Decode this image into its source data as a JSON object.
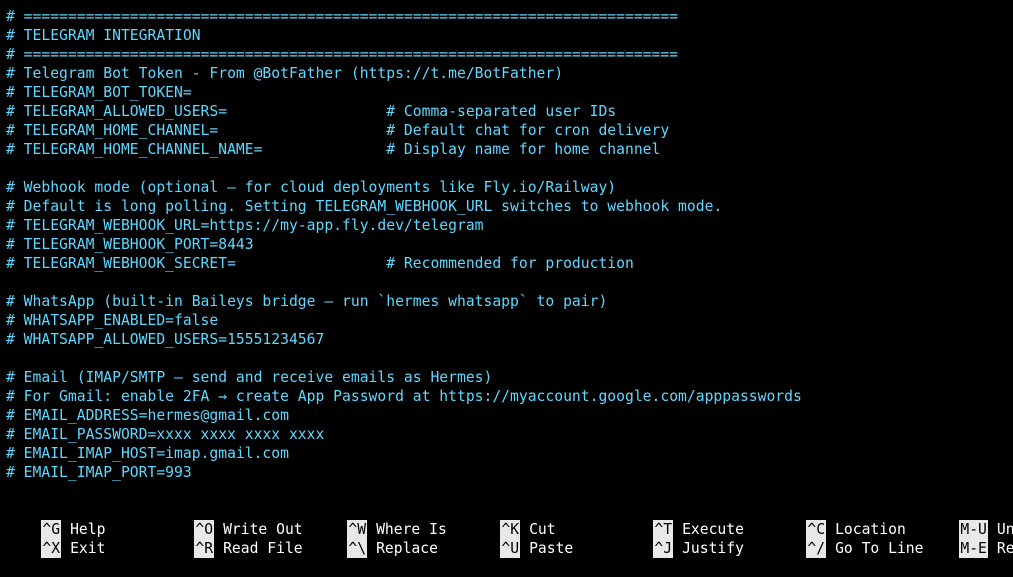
{
  "editor": {
    "lines": [
      "# ==========================================================================",
      "# TELEGRAM INTEGRATION",
      "# ==========================================================================",
      "# Telegram Bot Token - From @BotFather (https://t.me/BotFather)",
      "# TELEGRAM_BOT_TOKEN=",
      "# TELEGRAM_ALLOWED_USERS=                  # Comma-separated user IDs",
      "# TELEGRAM_HOME_CHANNEL=                   # Default chat for cron delivery",
      "# TELEGRAM_HOME_CHANNEL_NAME=              # Display name for home channel",
      "",
      "# Webhook mode (optional — for cloud deployments like Fly.io/Railway)",
      "# Default is long polling. Setting TELEGRAM_WEBHOOK_URL switches to webhook mode.",
      "# TELEGRAM_WEBHOOK_URL=https://my-app.fly.dev/telegram",
      "# TELEGRAM_WEBHOOK_PORT=8443",
      "# TELEGRAM_WEBHOOK_SECRET=                 # Recommended for production",
      "",
      "# WhatsApp (built-in Baileys bridge — run `hermes whatsapp` to pair)",
      "# WHATSAPP_ENABLED=false",
      "# WHATSAPP_ALLOWED_USERS=15551234567",
      "",
      "# Email (IMAP/SMTP — send and receive emails as Hermes)",
      "# For Gmail: enable 2FA → create App Password at https://myaccount.google.com/apppasswords",
      "# EMAIL_ADDRESS=hermes@gmail.com",
      "# EMAIL_PASSWORD=xxxx xxxx xxxx xxxx",
      "# EMAIL_IMAP_HOST=imap.gmail.com",
      "# EMAIL_IMAP_PORT=993"
    ],
    "text_color": "#5fd7ff",
    "background": "#000000"
  },
  "shortcuts": [
    {
      "key": "^G",
      "label": "Help"
    },
    {
      "key": "^O",
      "label": "Write Out"
    },
    {
      "key": "^W",
      "label": "Where Is"
    },
    {
      "key": "^K",
      "label": "Cut"
    },
    {
      "key": "^T",
      "label": "Execute"
    },
    {
      "key": "^C",
      "label": "Location"
    },
    {
      "key": "M-U",
      "label": "Undo"
    },
    {
      "key": "^X",
      "label": "Exit"
    },
    {
      "key": "^R",
      "label": "Read File"
    },
    {
      "key": "^\\",
      "label": "Replace"
    },
    {
      "key": "^U",
      "label": "Paste"
    },
    {
      "key": "^J",
      "label": "Justify"
    },
    {
      "key": "^/",
      "label": "Go To Line"
    },
    {
      "key": "M-E",
      "label": "Redo"
    }
  ]
}
